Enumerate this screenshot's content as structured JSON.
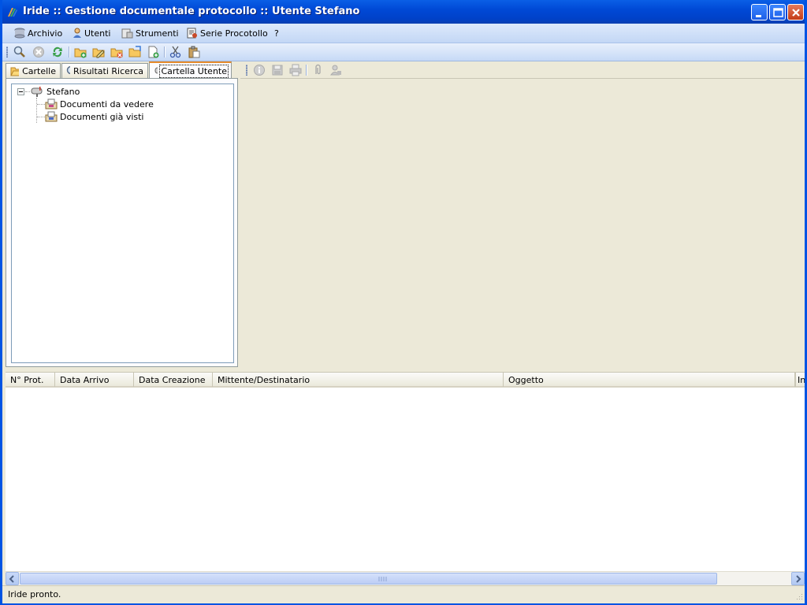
{
  "window": {
    "title": "Iride :: Gestione documentale protocollo :: Utente Stefano",
    "title_icon": "iride-logo-icon"
  },
  "menu": {
    "items": [
      {
        "label": "Archivio",
        "icon": "database-icon"
      },
      {
        "label": "Utenti",
        "icon": "user-icon"
      },
      {
        "label": "Strumenti",
        "icon": "tools-icon"
      },
      {
        "label": "Serie Procotollo",
        "icon": "protocol-series-icon"
      },
      {
        "label": "?",
        "icon": ""
      }
    ]
  },
  "toolbar": {
    "icons": [
      "search-icon",
      "cancel-icon",
      "refresh-icon",
      "new-folder-icon",
      "edit-folder-icon",
      "delete-folder-icon",
      "open-folder-icon",
      "new-document-icon",
      "cut-icon",
      "paste-icon"
    ]
  },
  "tabs": [
    {
      "label": "Cartelle",
      "icon": "folder-open-icon"
    },
    {
      "label": "Risultati Ricerca",
      "icon": "search-icon"
    },
    {
      "label": "Cartella Utente",
      "icon": "mailbox-icon",
      "active": true
    }
  ],
  "tree": {
    "root": {
      "label": "Stefano",
      "icon": "mailbox-icon",
      "expanded": true
    },
    "children": [
      {
        "label": "Documenti da vedere",
        "icon": "inbox-icon"
      },
      {
        "label": "Documenti già visti",
        "icon": "inbox-read-icon"
      }
    ]
  },
  "right_toolbar": {
    "icons": [
      "info-icon",
      "save-icon",
      "print-icon",
      "attach-icon",
      "user-stamp-icon"
    ]
  },
  "grid": {
    "columns": [
      "N° Prot.",
      "Data Arrivo",
      "Data Creazione",
      "Mittente/Destinatario",
      "Oggetto",
      "In"
    ]
  },
  "status": {
    "text": "Iride pronto."
  },
  "colors": {
    "title_bar": "#0049d6",
    "menu_bar": "#c3d7f5",
    "face": "#ece9d8",
    "active_tab_accent": "#e68b2c"
  }
}
